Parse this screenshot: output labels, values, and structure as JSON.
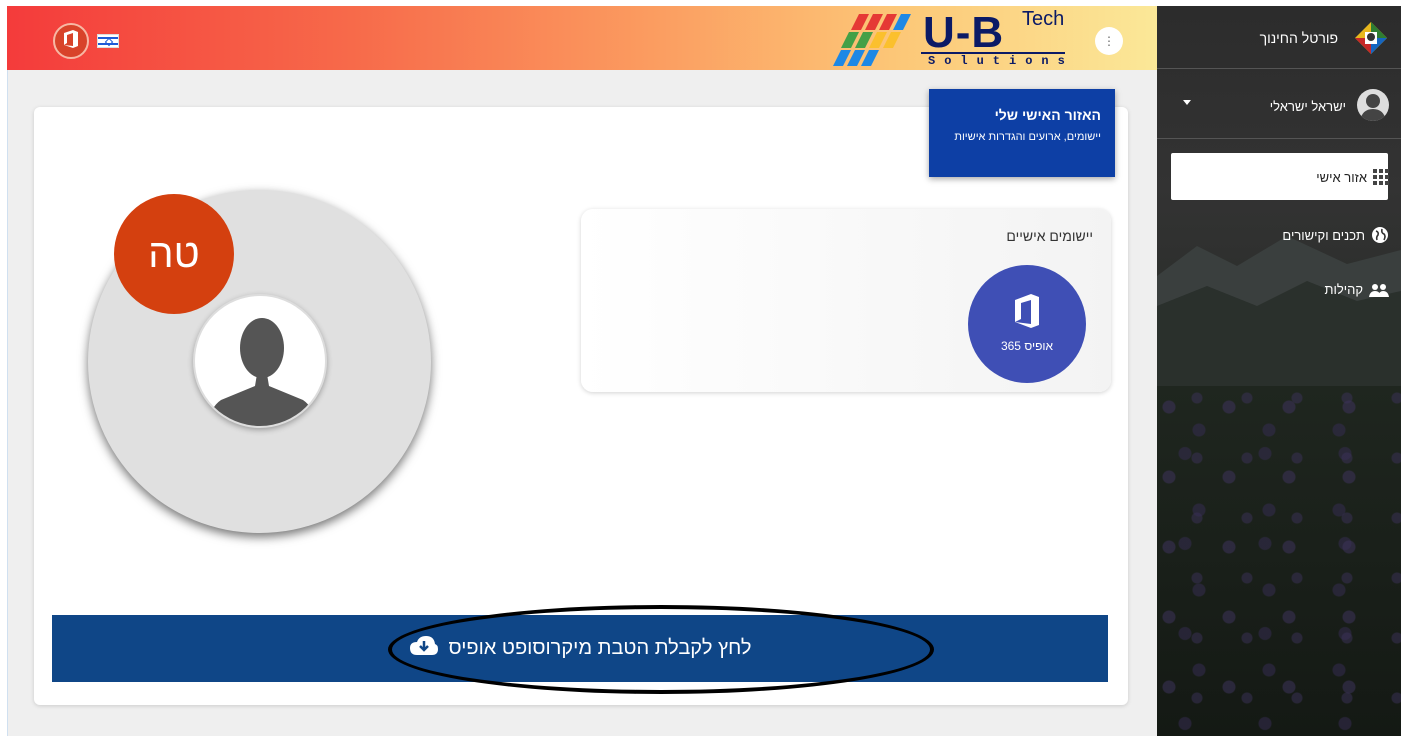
{
  "header": {
    "logo_main": "U-B",
    "logo_tech": "Tech",
    "logo_solutions": "Solutions",
    "kebab_label": "⋮"
  },
  "personal_area_card": {
    "title": "האזור האישי שלי",
    "subtitle": "יישומים, ארועים והגדרות אישיות"
  },
  "apps": {
    "title": "יישומים אישיים",
    "items": [
      {
        "label": "אופיס 365",
        "icon": "office-icon",
        "color": "#3f4fb5"
      }
    ]
  },
  "profile": {
    "initials": "טה",
    "initials_color": "#d4400f"
  },
  "cta": {
    "label": "לחץ לקבלת הטבת מיקרוסופט אופיס",
    "icon": "cloud-download-icon",
    "color": "#0f4687"
  },
  "sidebar": {
    "portal_title": "פורטל החינוך",
    "user_name": "ישראל ישראלי",
    "nav": [
      {
        "label": "אזור אישי",
        "icon": "grid-icon",
        "active": true
      },
      {
        "label": "תכנים וקישורים",
        "icon": "globe-icon",
        "active": false
      },
      {
        "label": "קהילות",
        "icon": "people-icon",
        "active": false
      }
    ]
  }
}
